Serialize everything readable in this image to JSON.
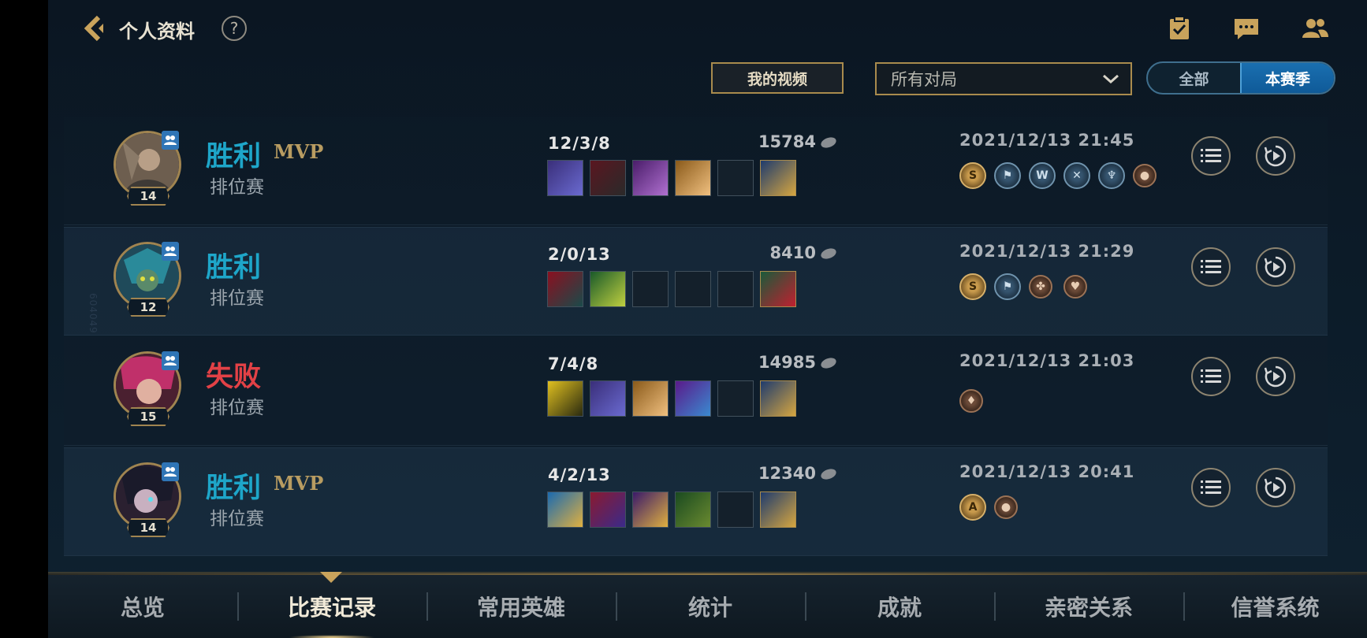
{
  "header": {
    "title": "个人资料",
    "help_glyph": "?",
    "watermark": "604049"
  },
  "toolbar": {
    "video_label": "我的视频",
    "filter_value": "所有对局",
    "season_all": "全部",
    "season_current": "本赛季"
  },
  "matches": [
    {
      "result": "胜利",
      "mvp": "MVP",
      "mode": "排位赛",
      "level": "14",
      "kda": "12/3/8",
      "gold": "15784",
      "date": "2021/12/13 21:45",
      "badges": [
        "S",
        "flag-icon",
        "wolf-icon",
        "cross-swords-icon",
        "shield-icon",
        "pouch-icon"
      ]
    },
    {
      "result": "胜利",
      "mvp": "",
      "mode": "排位赛",
      "level": "12",
      "kda": "2/0/13",
      "gold": "8410",
      "date": "2021/12/13 21:29",
      "badges": [
        "S",
        "flag-icon",
        "clover-icon",
        "heart-icon"
      ]
    },
    {
      "result": "失败",
      "mvp": "",
      "mode": "排位赛",
      "level": "15",
      "kda": "7/4/8",
      "gold": "14985",
      "date": "2021/12/13 21:03",
      "badges": [
        "drop-icon"
      ]
    },
    {
      "result": "胜利",
      "mvp": "MVP",
      "mode": "排位赛",
      "level": "14",
      "kda": "4/2/13",
      "gold": "12340",
      "date": "2021/12/13 20:41",
      "badges": [
        "A",
        "pouch-icon"
      ]
    }
  ],
  "tabs": [
    "总览",
    "比赛记录",
    "常用英雄",
    "统计",
    "成就",
    "亲密关系",
    "信誉系统"
  ],
  "colors": {
    "win": "#1ea6c9",
    "loss": "#e24146",
    "mvp": "#b89c61",
    "accent_gold": "#a98b4d",
    "toggle_active": "#1a6fb0"
  }
}
